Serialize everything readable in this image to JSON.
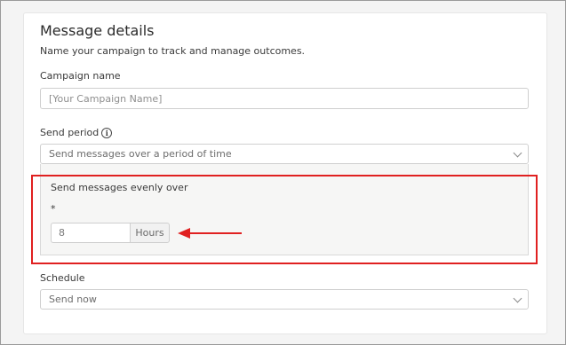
{
  "card": {
    "title": "Message details",
    "subtitle": "Name your campaign to track and manage outcomes."
  },
  "campaign_name": {
    "label": "Campaign name",
    "placeholder": "[Your Campaign Name]",
    "value": ""
  },
  "send_period": {
    "label": "Send period",
    "info_icon": "info-circle-icon",
    "selected": "Send messages over a period of time"
  },
  "evenly_over": {
    "label": "Send messages evenly over",
    "required_mark": "*",
    "value": "8",
    "unit": "Hours"
  },
  "annotation": {
    "color": "#e02020"
  },
  "schedule": {
    "label": "Schedule",
    "selected": "Send now"
  }
}
